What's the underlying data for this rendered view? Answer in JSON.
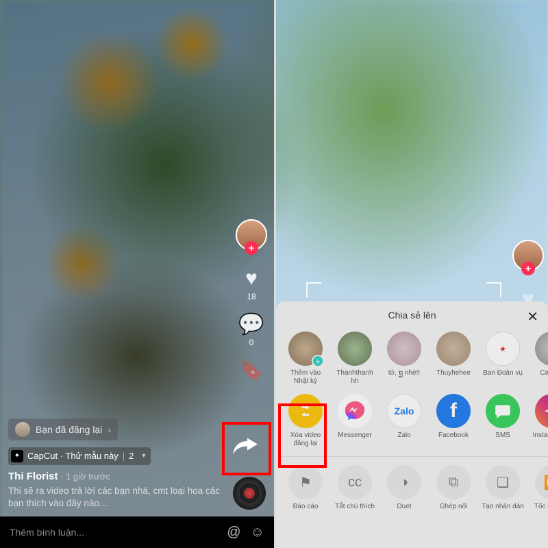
{
  "left": {
    "likes": "18",
    "comments": "0",
    "repost_tag": "Bạn đã đăng lại",
    "capcut_label": "CapCut · Thử mẫu này",
    "views": "2",
    "username": "Thi Florist",
    "time_sep": " · ",
    "timestamp": "1 giờ trước",
    "description": "Thi sẽ ra video trả lời các bạn nhá, cmt loại hoa các bạn thích vào đây nào…",
    "comment_placeholder": "Thêm bình luận..."
  },
  "right": {
    "sheet_title": "Chia sẻ lên",
    "row1": [
      {
        "label": "Thêm vào Nhật ký"
      },
      {
        "label": "Thanhthanh hh"
      },
      {
        "label": "tớ, ຖຼ nhè!!"
      },
      {
        "label": "Thuyhehee"
      },
      {
        "label": "Ban Đoàn vụ"
      },
      {
        "label": "CaTuon"
      }
    ],
    "row2": [
      {
        "label": "Xóa video đăng lại"
      },
      {
        "label": "Messenger"
      },
      {
        "label": "Zalo"
      },
      {
        "label": "Facebook"
      },
      {
        "label": "SMS"
      },
      {
        "label": "Instagr Direc"
      }
    ],
    "row3": [
      {
        "label": "Báo cáo"
      },
      {
        "label": "Tắt chú thích"
      },
      {
        "label": "Duet"
      },
      {
        "label": "Ghép nối"
      },
      {
        "label": "Tạo nhãn dán"
      },
      {
        "label": "Tốc đ phát l"
      }
    ]
  }
}
